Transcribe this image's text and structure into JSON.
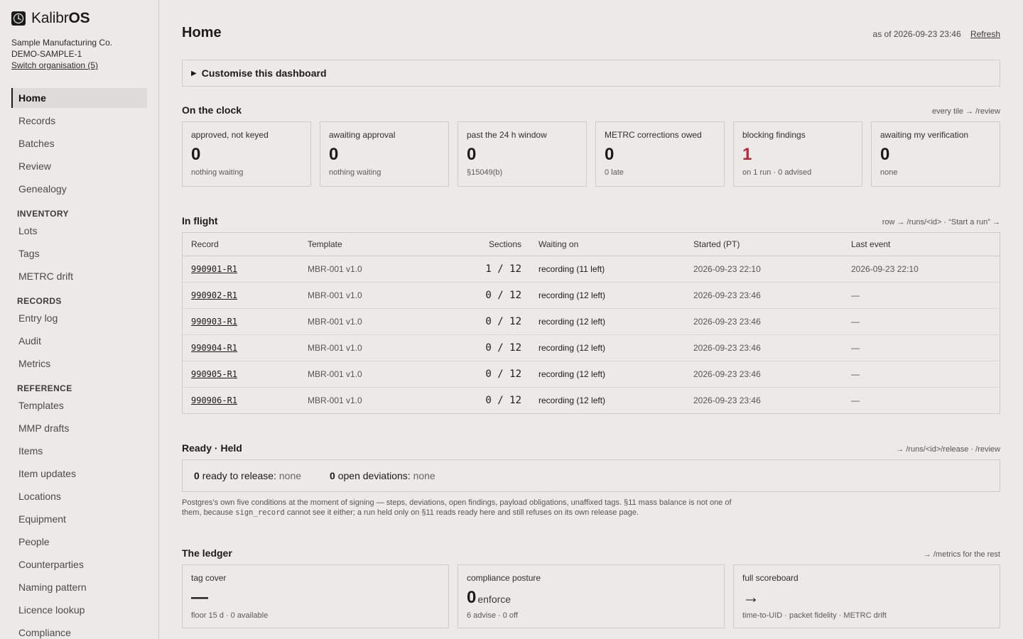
{
  "brand": {
    "prefix": "Kalibr",
    "suffix": "OS"
  },
  "org": {
    "name": "Sample Manufacturing Co.",
    "code": "DEMO-SAMPLE-1",
    "switch_label": "Switch organisation (5)"
  },
  "nav": {
    "home": "Home",
    "records": "Records",
    "batches": "Batches",
    "review": "Review",
    "genealogy": "Genealogy",
    "inventory_group": "INVENTORY",
    "lots": "Lots",
    "tags": "Tags",
    "metrc_drift": "METRC drift",
    "records_group": "RECORDS",
    "entry_log": "Entry log",
    "audit": "Audit",
    "metrics": "Metrics",
    "reference_group": "REFERENCE",
    "templates": "Templates",
    "mmp_drafts": "MMP drafts",
    "items": "Items",
    "item_updates": "Item updates",
    "locations": "Locations",
    "equipment": "Equipment",
    "people": "People",
    "counterparties": "Counterparties",
    "naming_pattern": "Naming pattern",
    "licence_lookup": "Licence lookup",
    "cut_item": "Compliance"
  },
  "header": {
    "title": "Home",
    "as_of": "as of 2026-09-23 23:46",
    "refresh": "Refresh"
  },
  "customise": {
    "label": "Customise this dashboard"
  },
  "on_the_clock": {
    "title": "On the clock",
    "hint": "every tile → /review",
    "tiles": [
      {
        "label": "approved, not keyed",
        "value": "0",
        "sub": "nothing waiting"
      },
      {
        "label": "awaiting approval",
        "value": "0",
        "sub": "nothing waiting"
      },
      {
        "label": "past the 24 h window",
        "value": "0",
        "sub": "§15049(b)"
      },
      {
        "label": "METRC corrections owed",
        "value": "0",
        "sub": "0 late"
      },
      {
        "label": "blocking findings",
        "value": "1",
        "sub": "on 1 run · 0 advised"
      },
      {
        "label": "awaiting my verification",
        "value": "0",
        "sub": "none"
      }
    ]
  },
  "in_flight": {
    "title": "In flight",
    "hint": "row → /runs/<id> · “Start a run” →",
    "columns": [
      "Record",
      "Template",
      "Sections",
      "Waiting on",
      "Started (PT)",
      "Last event"
    ],
    "rows": [
      {
        "record": "990901-R1",
        "template": "MBR-001 v1.0",
        "sections": "1 / 12",
        "waiting": "recording (11 left)",
        "started": "2026-09-23 22:10",
        "last": "2026-09-23 22:10"
      },
      {
        "record": "990902-R1",
        "template": "MBR-001 v1.0",
        "sections": "0 / 12",
        "waiting": "recording (12 left)",
        "started": "2026-09-23 23:46",
        "last": "—"
      },
      {
        "record": "990903-R1",
        "template": "MBR-001 v1.0",
        "sections": "0 / 12",
        "waiting": "recording (12 left)",
        "started": "2026-09-23 23:46",
        "last": "—"
      },
      {
        "record": "990904-R1",
        "template": "MBR-001 v1.0",
        "sections": "0 / 12",
        "waiting": "recording (12 left)",
        "started": "2026-09-23 23:46",
        "last": "—"
      },
      {
        "record": "990905-R1",
        "template": "MBR-001 v1.0",
        "sections": "0 / 12",
        "waiting": "recording (12 left)",
        "started": "2026-09-23 23:46",
        "last": "—"
      },
      {
        "record": "990906-R1",
        "template": "MBR-001 v1.0",
        "sections": "0 / 12",
        "waiting": "recording (12 left)",
        "started": "2026-09-23 23:46",
        "last": "—"
      }
    ]
  },
  "ready_held": {
    "title": "Ready · Held",
    "hint": "→ /runs/<id>/release · /review",
    "ready_count": "0",
    "ready_label": "ready to release:",
    "ready_value": "none",
    "dev_count": "0",
    "dev_label": "open deviations:",
    "dev_value": "none",
    "note_a": "Postgres’s own five conditions at the moment of signing — steps, deviations, open findings, payload obligations, unaffixed tags. §11 mass balance is not one of them, because ",
    "note_code": "sign_record",
    "note_b": " cannot see it either; a run held only on §11 reads ready here and still refuses on its own release page."
  },
  "ledger": {
    "title": "The ledger",
    "hint": "→ /metrics for the rest",
    "tiles": [
      {
        "label": "tag cover",
        "value": "—",
        "unit": "",
        "sub": "floor 15 d · 0 available"
      },
      {
        "label": "compliance posture",
        "value": "0",
        "unit": "enforce",
        "sub": "6 advise · 0 off"
      },
      {
        "label": "full scoreboard",
        "value": "→",
        "unit": "",
        "sub": "time-to-UID · packet fidelity · METRC drift"
      }
    ]
  }
}
